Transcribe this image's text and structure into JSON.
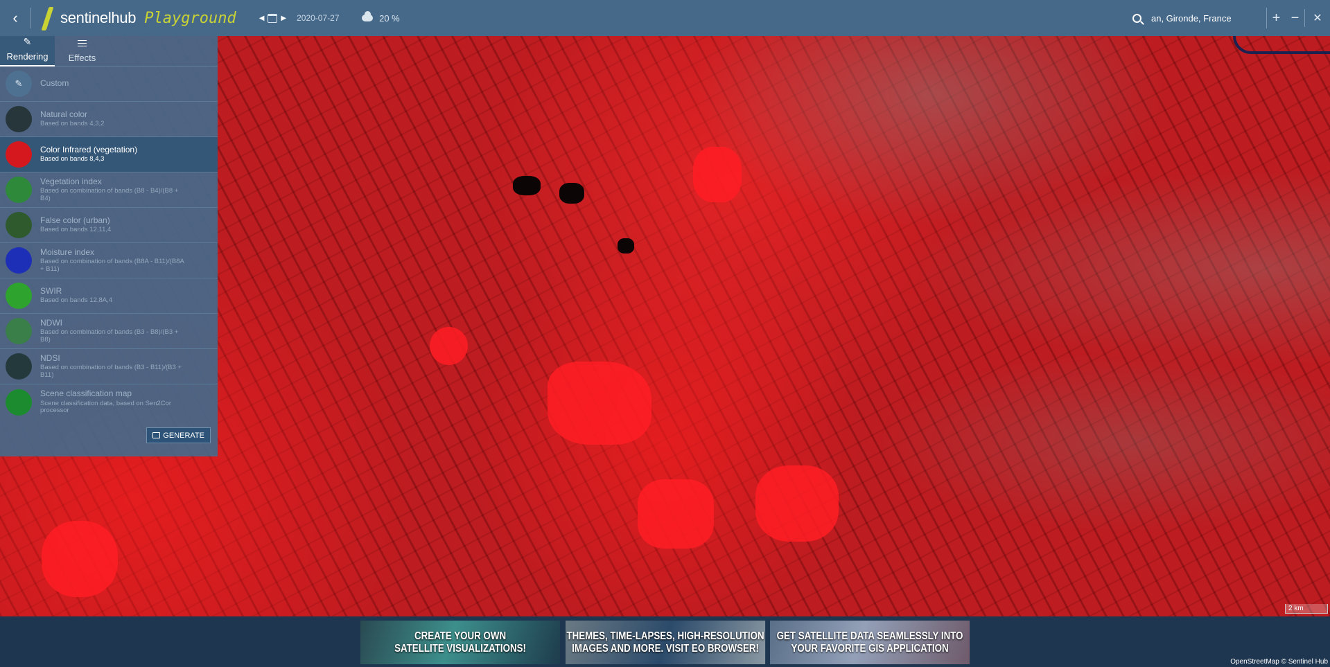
{
  "header": {
    "brand": "sentinelhub",
    "product": "Playground",
    "date": "2020-07-27",
    "cloud_coverage": "20 %",
    "location_value": "an, Gironde, France",
    "zoom_in": "+",
    "zoom_out": "−"
  },
  "sidebar": {
    "tabs": [
      {
        "label": "Rendering",
        "active": true
      },
      {
        "label": "Effects",
        "active": false
      }
    ],
    "items": [
      {
        "title": "Custom",
        "subtitle": "",
        "color": "#4f7191"
      },
      {
        "title": "Natural color",
        "subtitle": "Based on bands 4,3,2",
        "color": "#27363a"
      },
      {
        "title": "Color Infrared (vegetation)",
        "subtitle": "Based on bands 8,4,3",
        "color": "#d5181d",
        "active": true
      },
      {
        "title": "Vegetation index",
        "subtitle": "Based on combination of bands (B8 - B4)/(B8 + B4)",
        "color": "#2e8a3a"
      },
      {
        "title": "False color (urban)",
        "subtitle": "Based on bands 12,11,4",
        "color": "#2e5a2e"
      },
      {
        "title": "Moisture index",
        "subtitle": "Based on combination of bands (B8A - B11)/(B8A + B11)",
        "color": "#1c2fb6"
      },
      {
        "title": "SWIR",
        "subtitle": "Based on bands 12,8A,4",
        "color": "#2ea32e"
      },
      {
        "title": "NDWI",
        "subtitle": "Based on combination of bands (B3 - B8)/(B3 + B8)",
        "color": "#3a7f4a"
      },
      {
        "title": "NDSI",
        "subtitle": "Based on combination of bands (B3 - B11)/(B3 + B11)",
        "color": "#24393c"
      },
      {
        "title": "Scene classification map",
        "subtitle": "Scene classification data, based on Sen2Cor processor",
        "color": "#1c8a2e"
      }
    ],
    "generate_label": "GENERATE"
  },
  "map": {
    "scale_label": "2 km",
    "attribution": "OpenStreetMap © Sentinel Hub"
  },
  "banners": [
    {
      "line1": "CREATE YOUR OWN",
      "line2": "SATELLITE VISUALIZATIONS!"
    },
    {
      "line1": "THEMES, TIME-LAPSES, HIGH-RESOLUTION",
      "line2": "IMAGES AND MORE. VISIT EO BROWSER!"
    },
    {
      "line1": "GET SATELLITE DATA SEAMLESSLY INTO",
      "line2": "YOUR FAVORITE GIS APPLICATION"
    }
  ]
}
